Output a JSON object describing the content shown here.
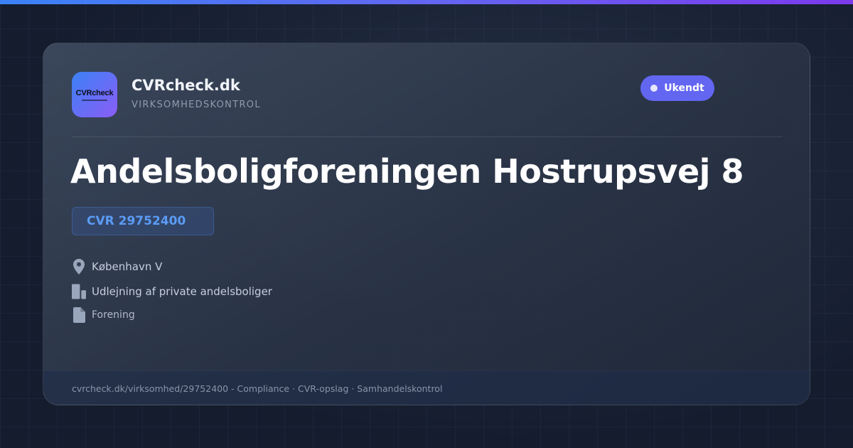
{
  "colors": {
    "accent": "#6366f1",
    "brand_gradient_start": "#3b82f6",
    "brand_gradient_end": "#8b5cf6",
    "cvr_text": "#5b9bf5",
    "background": "#141c2e"
  },
  "brand": {
    "logo_text": "CVRcheck",
    "name": "CVRcheck.dk",
    "tagline": "VIRKSOMHEDSKONTROL"
  },
  "status": {
    "label": "Ukendt",
    "icon": "status-dot-icon"
  },
  "company": {
    "name": "Andelsboligforeningen Hostrupsvej 8",
    "cvr": "CVR 29752400"
  },
  "details": {
    "location": {
      "icon": "location-pin-icon",
      "text": "København V"
    },
    "industry": {
      "icon": "building-icon",
      "text": "Udlejning af private andelsboliger"
    },
    "type": {
      "icon": "document-icon",
      "text": "Forening"
    }
  },
  "footer": {
    "text": "cvrcheck.dk/virksomhed/29752400 - Compliance · CVR-opslag · Samhandelskontrol"
  }
}
